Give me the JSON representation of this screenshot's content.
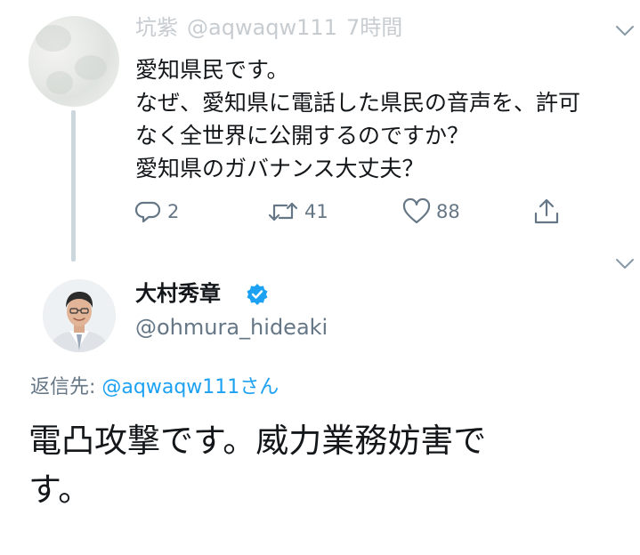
{
  "parent_tweet": {
    "display_name": "坑紫",
    "handle": "@aqwaqw111",
    "time": "7時間",
    "lines": [
      "愛知県民です。",
      "なぜ、愛知県に電話した県民の音声を、許可",
      "なく全世界に公開するのですか？",
      "愛知県のガバナンス大丈夫？"
    ],
    "actions": {
      "reply": {
        "icon": "reply-icon",
        "count": "2"
      },
      "retweet": {
        "icon": "retweet-icon",
        "count": "41"
      },
      "like": {
        "icon": "heart-icon",
        "count": "88"
      },
      "share": {
        "icon": "share-icon"
      }
    }
  },
  "main_tweet": {
    "display_name": "大村秀章",
    "verified": true,
    "handle": "@ohmura_hideaki",
    "reply_to_label": "返信先: ",
    "reply_to_mention": "@aqwaqw111",
    "reply_to_suffix": "さん",
    "lines": [
      "電凸攻撃です。威力業務妨害で",
      "す。"
    ]
  },
  "colors": {
    "accent": "#1da1f2",
    "secondary_text": "#657786",
    "primary_text": "#14171a",
    "thread_line": "#ccd6dd"
  }
}
